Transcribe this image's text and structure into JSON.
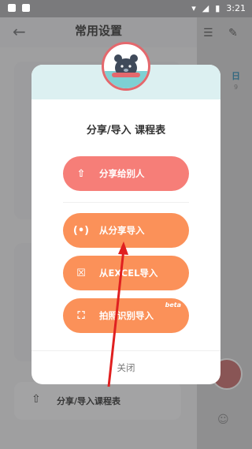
{
  "status_bar": {
    "time": "3:21"
  },
  "background": {
    "page_title": "常用设置",
    "bottom_row_label": "分享/导入课程表",
    "right_day_label": "日",
    "right_day_num": "9"
  },
  "dialog": {
    "title": "分享/导入 课程表",
    "buttons": [
      {
        "label": "分享给别人",
        "icon": "upload-icon"
      },
      {
        "label": "从分享导入",
        "icon": "code-icon"
      },
      {
        "label": "从EXCEL导入",
        "icon": "excel-icon"
      },
      {
        "label": "拍照识别导入",
        "icon": "scan-icon",
        "badge": "beta"
      }
    ],
    "close_label": "关闭"
  },
  "colors": {
    "share_button": "#f67e78",
    "import_button": "#fb9159",
    "dialog_header": "#dcf0f1",
    "annotation_arrow": "#e02020"
  }
}
